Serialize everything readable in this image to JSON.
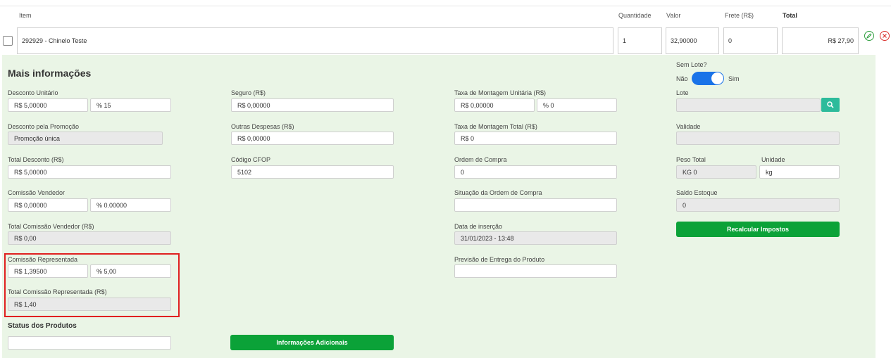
{
  "header": {
    "item": "Item",
    "quantidade": "Quantidade",
    "valor": "Valor",
    "frete": "Frete (R$)",
    "total": "Total"
  },
  "row": {
    "item": "292929 - Chinelo Teste",
    "quantidade": "1",
    "valor": "32,90000",
    "frete": "0",
    "total": "R$ 27,90"
  },
  "panel": {
    "title": "Mais informações",
    "col1": {
      "desconto_unitario": {
        "label": "Desconto Unitário",
        "valor": "R$ 5,00000",
        "percent": "% 15"
      },
      "desconto_promocao": {
        "label": "Desconto pela Promoção",
        "value": "Promoção única"
      },
      "total_desconto": {
        "label": "Total Desconto (R$)",
        "value": "R$ 5,00000"
      },
      "comissao_vendedor": {
        "label": "Comissão Vendedor",
        "valor": "R$ 0,00000",
        "percent": "% 0.00000"
      },
      "total_comissao_vendedor": {
        "label": "Total Comissão Vendedor (R$)",
        "value": "R$ 0,00"
      },
      "comissao_representada": {
        "label": "Comissão Representada",
        "valor": "R$ 1,39500",
        "percent": "% 5,00"
      },
      "total_comissao_representada": {
        "label": "Total Comissão Representada (R$)",
        "value": "R$ 1,40"
      },
      "status_produtos": {
        "label": "Status dos Produtos",
        "value": ""
      }
    },
    "col2": {
      "seguro": {
        "label": "Seguro (R$)",
        "value": "R$ 0,00000"
      },
      "outras_despesas": {
        "label": "Outras Despesas (R$)",
        "value": "R$ 0,00000"
      },
      "codigo_cfop": {
        "label": "Código CFOP",
        "value": "5102"
      },
      "info_adicionais_button": "Informações Adicionais"
    },
    "col3": {
      "taxa_montagem_unitaria": {
        "label": "Taxa de Montagem Unitária (R$)",
        "valor": "R$ 0,00000",
        "percent": "% 0"
      },
      "taxa_montagem_total": {
        "label": "Taxa de Montagem Total (R$)",
        "value": "R$ 0"
      },
      "ordem_compra": {
        "label": "Ordem de Compra",
        "value": "0"
      },
      "situacao_ordem": {
        "label": "Situação da Ordem de Compra",
        "value": ""
      },
      "data_insercao": {
        "label": "Data de inserção",
        "value": "31/01/2023 - 13:48"
      },
      "previsao_entrega": {
        "label": "Previsão de Entrega do Produto",
        "value": ""
      }
    },
    "col4": {
      "sem_lote": {
        "label": "Sem Lote?",
        "off": "Não",
        "on": "Sim",
        "checked": true
      },
      "lote": {
        "label": "Lote",
        "value": ""
      },
      "validade": {
        "label": "Validade",
        "value": ""
      },
      "peso_total": {
        "label": "Peso Total",
        "value": "KG 0"
      },
      "unidade": {
        "label": "Unidade",
        "value": "kg"
      },
      "saldo_estoque": {
        "label": "Saldo Estoque",
        "value": "0"
      },
      "recalcular_button": "Recalcular Impostos"
    }
  },
  "colors": {
    "panel_bg": "#eaf5e6",
    "green_button": "#0ba238",
    "toggle": "#1a73e8",
    "highlight": "#e02020",
    "search_button": "#2dbb9b"
  },
  "icons": {
    "edit": "pencil-circle-icon",
    "remove": "close-circle-icon",
    "search": "magnifier-icon"
  }
}
